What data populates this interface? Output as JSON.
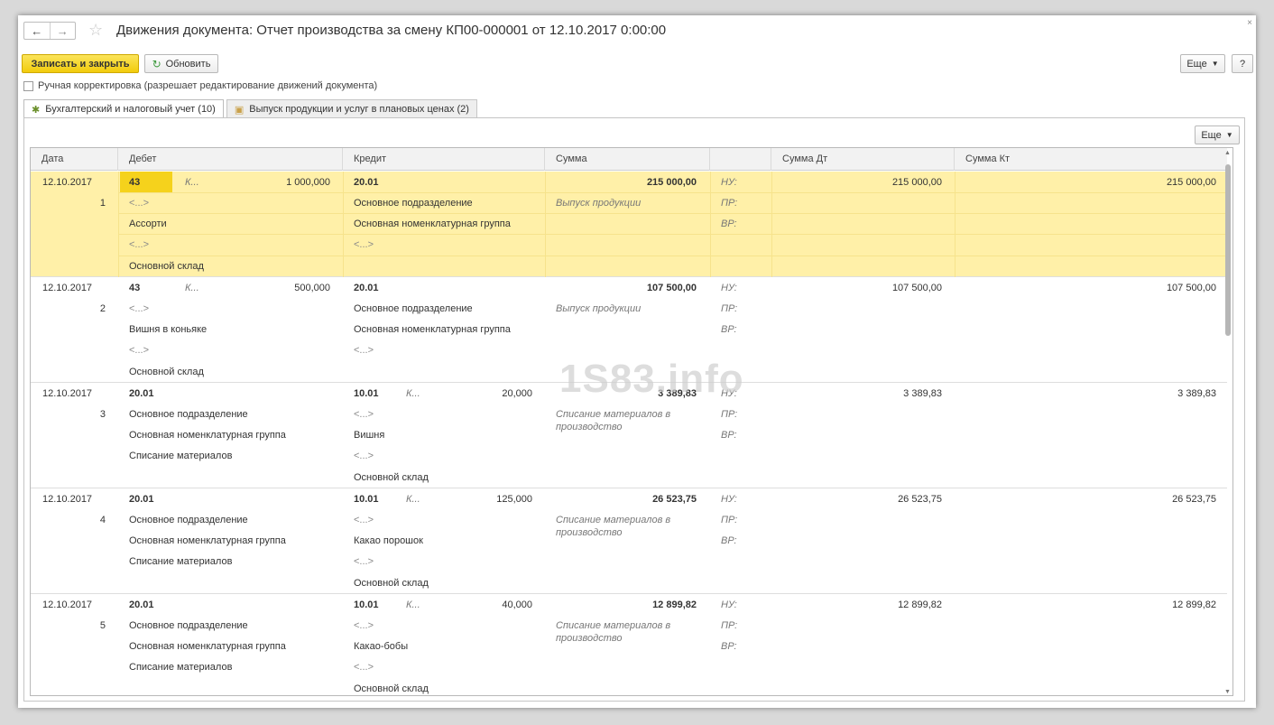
{
  "window": {
    "title": "Движения документа: Отчет производства за смену КП00-000001 от 12.10.2017 0:00:00",
    "close_glyph": "×"
  },
  "toolbar": {
    "save_close_label": "Записать и закрыть",
    "refresh_label": "Обновить",
    "more_label": "Еще",
    "help_label": "?"
  },
  "manual_edit": {
    "label": "Ручная корректировка (разрешает редактирование движений документа)",
    "checked": false
  },
  "tabs": [
    {
      "label": "Бухгалтерский и налоговый учет (10)",
      "active": true
    },
    {
      "label": "Выпуск продукции и услуг в плановых ценах (2)",
      "active": false
    }
  ],
  "grid": {
    "more_label": "Еще",
    "columns": [
      "Дата",
      "Дебет",
      "Кредит",
      "Сумма",
      "",
      "Сумма Дт",
      "Сумма Кт"
    ],
    "rows": [
      {
        "date": "12.10.2017",
        "num": "1",
        "selected": true,
        "debit": {
          "account": "43",
          "qty_label": "К...",
          "qty": "1 000,000",
          "lines": [
            "<...>",
            "Ассорти",
            "<...>",
            "Основной склад"
          ]
        },
        "credit": {
          "account": "20.01",
          "qty_label": "",
          "qty": "",
          "lines": [
            "Основное подразделение",
            "Основная номенклатурная группа",
            "<...>",
            ""
          ]
        },
        "sum": "215 000,00",
        "content": "Выпуск продукции",
        "nu": "НУ:",
        "pr": "ПР:",
        "vr": "ВР:",
        "sum_dt": "215 000,00",
        "sum_kt": "215 000,00"
      },
      {
        "date": "12.10.2017",
        "num": "2",
        "selected": false,
        "debit": {
          "account": "43",
          "qty_label": "К...",
          "qty": "500,000",
          "lines": [
            "<...>",
            "Вишня в коньяке",
            "<...>",
            "Основной склад"
          ]
        },
        "credit": {
          "account": "20.01",
          "qty_label": "",
          "qty": "",
          "lines": [
            "Основное подразделение",
            "Основная номенклатурная группа",
            "<...>",
            ""
          ]
        },
        "sum": "107 500,00",
        "content": "Выпуск продукции",
        "nu": "НУ:",
        "pr": "ПР:",
        "vr": "ВР:",
        "sum_dt": "107 500,00",
        "sum_kt": "107 500,00"
      },
      {
        "date": "12.10.2017",
        "num": "3",
        "selected": false,
        "debit": {
          "account": "20.01",
          "qty_label": "",
          "qty": "",
          "lines": [
            "Основное подразделение",
            "Основная номенклатурная группа",
            "Списание материалов",
            ""
          ]
        },
        "credit": {
          "account": "10.01",
          "qty_label": "К...",
          "qty": "20,000",
          "lines": [
            "<...>",
            "Вишня",
            "<...>",
            "Основной склад"
          ]
        },
        "sum": "3 389,83",
        "content": "Списание материалов в производство",
        "nu": "НУ:",
        "pr": "ПР:",
        "vr": "ВР:",
        "sum_dt": "3 389,83",
        "sum_kt": "3 389,83"
      },
      {
        "date": "12.10.2017",
        "num": "4",
        "selected": false,
        "debit": {
          "account": "20.01",
          "qty_label": "",
          "qty": "",
          "lines": [
            "Основное подразделение",
            "Основная номенклатурная группа",
            "Списание материалов",
            ""
          ]
        },
        "credit": {
          "account": "10.01",
          "qty_label": "К...",
          "qty": "125,000",
          "lines": [
            "<...>",
            "Какао порошок",
            "<...>",
            "Основной склад"
          ]
        },
        "sum": "26 523,75",
        "content": "Списание материалов в производство",
        "nu": "НУ:",
        "pr": "ПР:",
        "vr": "ВР:",
        "sum_dt": "26 523,75",
        "sum_kt": "26 523,75"
      },
      {
        "date": "12.10.2017",
        "num": "5",
        "selected": false,
        "debit": {
          "account": "20.01",
          "qty_label": "",
          "qty": "",
          "lines": [
            "Основное подразделение",
            "Основная номенклатурная группа",
            "Списание материалов",
            ""
          ]
        },
        "credit": {
          "account": "10.01",
          "qty_label": "К...",
          "qty": "40,000",
          "lines": [
            "<...>",
            "Какао-бобы",
            "<...>",
            "Основной склад"
          ]
        },
        "sum": "12 899,82",
        "content": "Списание материалов в производство",
        "nu": "НУ:",
        "pr": "ПР:",
        "vr": "ВР:",
        "sum_dt": "12 899,82",
        "sum_kt": "12 899,82"
      }
    ]
  },
  "watermark": "1S83.info",
  "colors": {
    "primary_button": "#f2cc0c",
    "selected_row": "#fff0a8",
    "selected_cell": "#f5d21c",
    "refresh_icon": "#3f9a3f"
  },
  "icons": {
    "back": "back-arrow-icon",
    "forward": "forward-arrow-icon",
    "favorite": "star-icon",
    "refresh": "refresh-icon",
    "tab1": "accounting-icon",
    "tab2": "document-icon"
  }
}
